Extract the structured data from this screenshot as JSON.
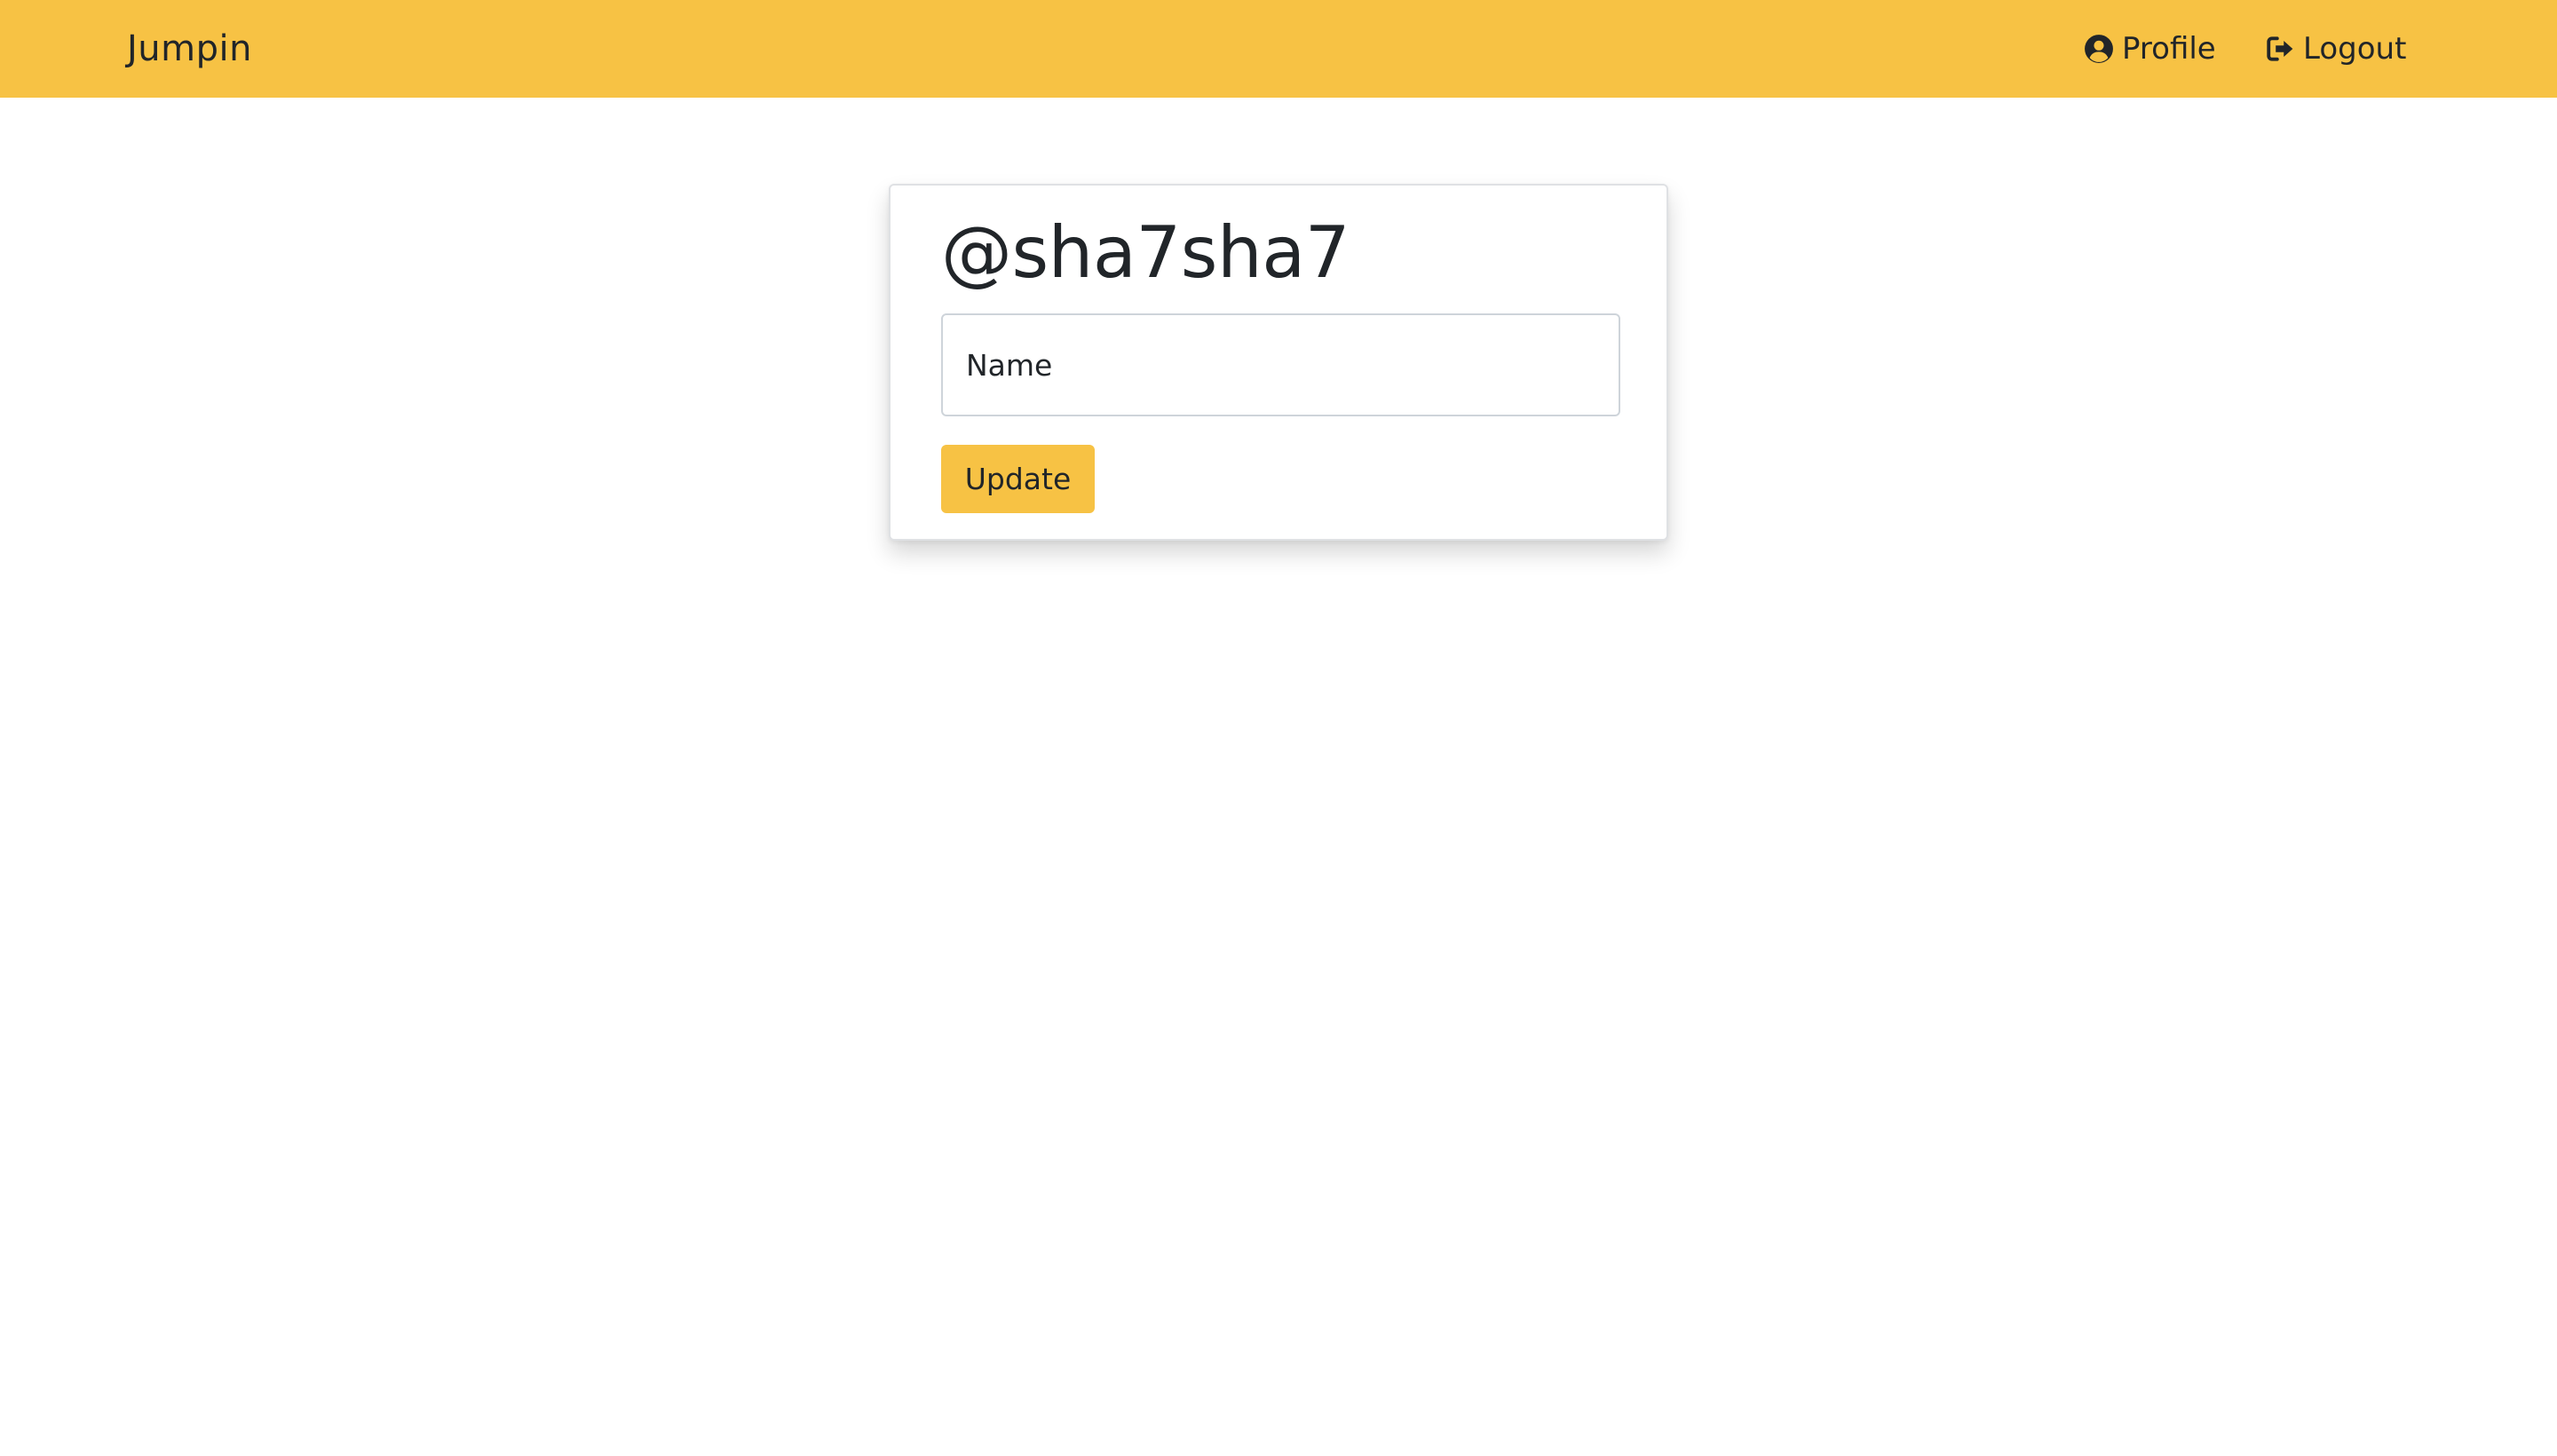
{
  "navbar": {
    "brand": "Jumpin",
    "background_color": "#f7c244",
    "links": [
      {
        "label": "Profile",
        "icon": "user-circle-icon"
      },
      {
        "label": "Logout",
        "icon": "sign-out-icon"
      }
    ]
  },
  "profile_card": {
    "username": "@sha7sha7",
    "name_input": {
      "placeholder": "Name",
      "value": ""
    },
    "update_button_label": "Update",
    "accent_color": "#f7c244"
  }
}
